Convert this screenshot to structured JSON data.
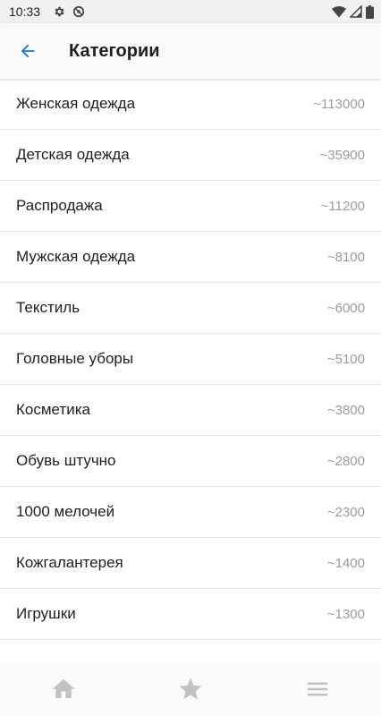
{
  "status_bar": {
    "time": "10:33"
  },
  "header": {
    "title": "Категории"
  },
  "categories": [
    {
      "name": "Женская одежда",
      "count": "~113000"
    },
    {
      "name": "Детская одежда",
      "count": "~35900"
    },
    {
      "name": "Распродажа",
      "count": "~11200"
    },
    {
      "name": "Мужская одежда",
      "count": "~8100"
    },
    {
      "name": "Текстиль",
      "count": "~6000"
    },
    {
      "name": "Головные уборы",
      "count": "~5100"
    },
    {
      "name": "Косметика",
      "count": "~3800"
    },
    {
      "name": "Обувь штучно",
      "count": "~2800"
    },
    {
      "name": "1000 мелочей",
      "count": "~2300"
    },
    {
      "name": "Кожгалантерея",
      "count": "~1400"
    },
    {
      "name": "Игрушки",
      "count": "~1300"
    }
  ],
  "bottom_nav": {
    "icons": [
      "home-icon",
      "star-icon",
      "menu-icon"
    ]
  },
  "colors": {
    "accent": "#1976d2",
    "nav_icon": "#c2c2c2",
    "count_text": "#9b9b9b"
  }
}
